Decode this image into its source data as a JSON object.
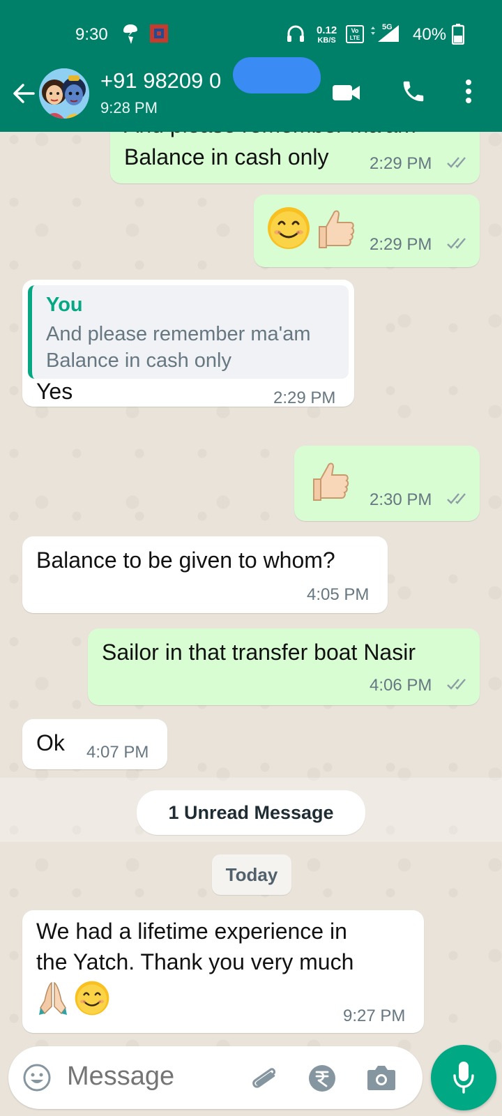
{
  "status_bar": {
    "time": "9:30",
    "net_speed_value": "0.12",
    "net_speed_unit": "KB/S",
    "volte": "Vo LTE",
    "network": "5G",
    "battery": "40%"
  },
  "header": {
    "contact": "+91 98209 0",
    "last_seen": "9:28 PM",
    "back_icon": "arrow-left-icon",
    "video_icon": "video-call-icon",
    "call_icon": "phone-icon",
    "menu_icon": "more-vert-icon"
  },
  "messages": [
    {
      "direction": "out",
      "text_line1": "And please remember ma'am",
      "text_line2": "Balance in cash only",
      "time": "2:29 PM"
    },
    {
      "direction": "out",
      "emoji": "smile-thumbs-up",
      "time": "2:29 PM"
    },
    {
      "direction": "in",
      "quote_author": "You",
      "quote_line1": "And please remember ma'am",
      "quote_line2": "Balance in cash only",
      "text": "Yes",
      "time": "2:29 PM"
    },
    {
      "direction": "out",
      "emoji": "thumbs-up",
      "time": "2:30 PM"
    },
    {
      "direction": "in",
      "text": "Balance to be given to whom?",
      "time": "4:05 PM"
    },
    {
      "direction": "out",
      "text": "Sailor in that transfer boat Nasir",
      "time": "4:06 PM"
    },
    {
      "direction": "in",
      "text": "Ok",
      "time": "4:07 PM"
    },
    {
      "direction": "in",
      "text_line1": "We had a lifetime experience  in",
      "text_line2": "the Yatch. Thank you very much",
      "emoji": "folded-hands-smile",
      "time": "9:27 PM"
    }
  ],
  "unread_label": "1 Unread Message",
  "day_label": "Today",
  "composer": {
    "placeholder": "Message",
    "icons": [
      "emoji-icon",
      "attach-icon",
      "rupee-icon",
      "camera-icon",
      "mic-icon"
    ]
  },
  "colors": {
    "header": "#008069",
    "outgoing_bubble": "#d9fdd3",
    "incoming_bubble": "#ffffff",
    "accent": "#00a884",
    "read_ticks": "#8c9da5"
  }
}
